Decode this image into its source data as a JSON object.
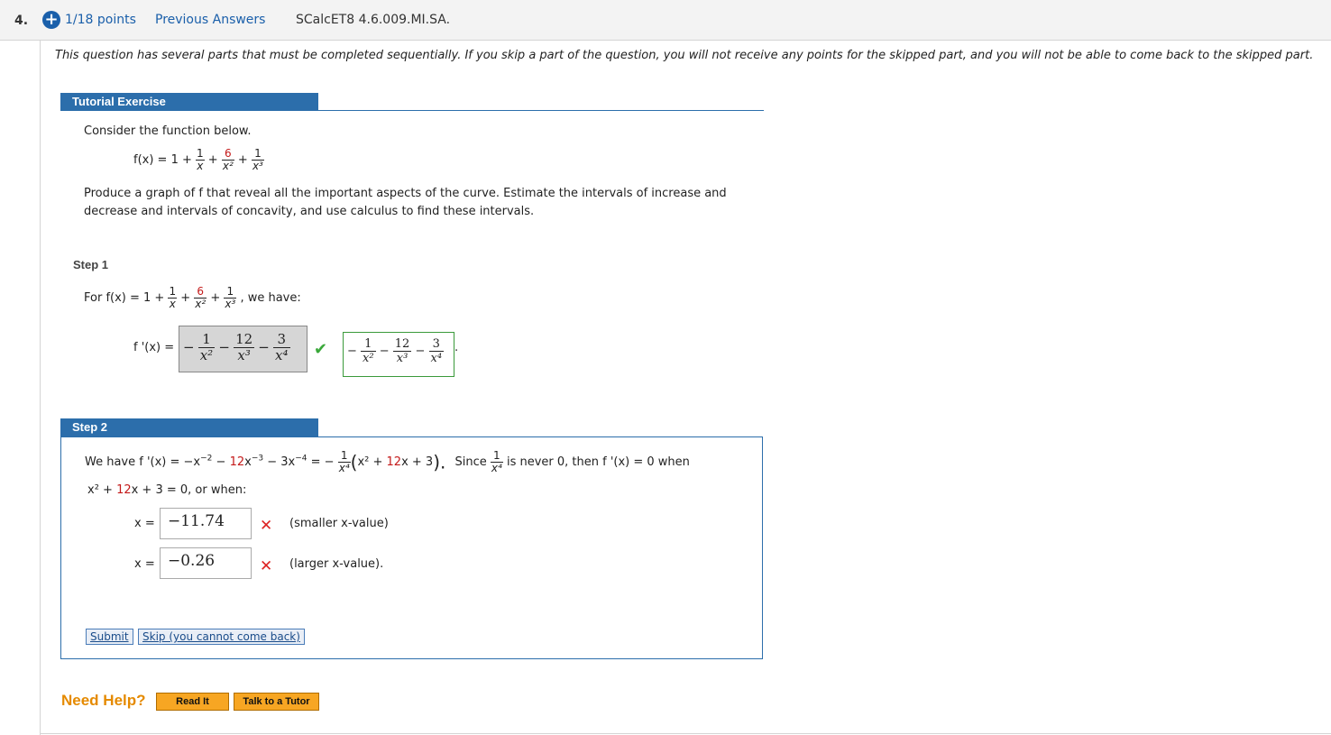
{
  "header": {
    "question_number": "4.",
    "points": "1/18 points",
    "previous_answers": "Previous Answers",
    "question_code": "SCalcET8 4.6.009.MI.SA."
  },
  "notice": "This question has several parts that must be completed sequentially. If you skip a part of the question, you will not receive any points for the skipped part, and you will not be able to come back to the skipped part.",
  "tutorial": {
    "title": "Tutorial Exercise",
    "intro": "Consider the function below.",
    "function_label": "f(x) = 1 +",
    "frac_one": "1",
    "frac_six": "6",
    "den_x": "x",
    "den_x2": "x²",
    "den_x3": "x³",
    "task_line1": "Produce a graph of f that reveal all the important aspects of the curve. Estimate the intervals of increase and",
    "task_line2": "decrease and intervals of concavity, and use calculus to find these intervals."
  },
  "step1": {
    "label": "Step 1",
    "for_text": "For  f(x) = 1 +",
    "we_have": ",   we have:",
    "fprime_label": "f '(x) =",
    "answer": {
      "n1": "1",
      "d1": "x²",
      "n2": "12",
      "d2": "x³",
      "n3": "3",
      "d3": "x⁴",
      "minus": "−"
    },
    "correct": {
      "n1": "1",
      "d1": "x²",
      "n2": "12",
      "d2": "x³",
      "n3": "3",
      "d3": "x⁴"
    }
  },
  "step2": {
    "label": "Step 2",
    "line1_a": "We have  f '(x) = −x",
    "exp_m2": "−2",
    "line1_b": " − ",
    "coef12": "12",
    "line1_c": "x",
    "exp_m3": "−3",
    "line1_d": " − 3x",
    "exp_m4": "−4",
    "line1_e": " = −",
    "frac_num": "1",
    "frac_den": "x⁴",
    "paren_open": "(",
    "poly_a": "x² + ",
    "poly_b": "x + 3",
    "paren_close": ").",
    "since": "Since",
    "since_tail": "is never 0, then  f '(x) = 0  when",
    "line2_a": "x² + ",
    "line2_b": "x + 3 = 0,  or when:",
    "x_label": "x =",
    "x1_value": "−11.74",
    "x1_note": "(smaller x-value)",
    "x2_value": "−0.26",
    "x2_note": "(larger x-value).",
    "submit": "Submit",
    "skip": "Skip (you cannot come back)"
  },
  "help": {
    "label": "Need Help?",
    "read_it": "Read It",
    "talk_to_tutor": "Talk to a Tutor"
  },
  "colors": {
    "accent_blue": "#2c6eab",
    "link_blue": "#1a5faa",
    "red_highlight": "#c41a1a",
    "correct_green": "#3a9a3a",
    "help_orange": "#e58a00"
  }
}
